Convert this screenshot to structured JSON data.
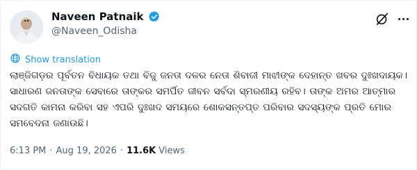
{
  "author": {
    "name": "Naveen Patnaik",
    "handle": "@Naveen_Odisha"
  },
  "post": {
    "show_translation": "Show translation",
    "text": "ଲାଞ୍ଜିଗଡ଼ର ପୂର୍ବତନ ବିଧାୟକ ତଥା ବିଜୁ ଜନତା ଦଳର ନେତା ଶିବାଜୀ ମାଝୀଙ୍କ ଦେହାନ୍ତ ଖବର ଦୁଃଖଦାୟକ। ସାଧାରଣ ଜନତାଙ୍କ ସେବାରେ ତାଙ୍କର ସମର୍ପିତ ଜୀବନ ସର୍ବଦା ସ୍ମରଣୀୟ ରହିବ। ତାଙ୍କ ଅମର ଆତ୍ମାର ସଦଗତି କାମନା କରିବା ସହ ଏପରି ଦୁଃଖଦ ସମୟରେ ଶୋକସନ୍ତପ୍ତ ପରିବାର ସଦସ୍ୟଙ୍କ ପ୍ରତି ମୋର ସମବେଦନା ଜଣାଉଛି।",
    "time": "6:13 PM",
    "date": "Aug 19, 2026",
    "views_count": "11.6K",
    "views_label": "Views"
  },
  "icons": {
    "verified": "verified-badge-icon",
    "grok": "grok-icon",
    "more": "more-options-icon",
    "translate": "translate-globe-icon"
  },
  "colors": {
    "accent": "#1d9bf0",
    "text": "#0f1419",
    "secondary": "#536471"
  }
}
